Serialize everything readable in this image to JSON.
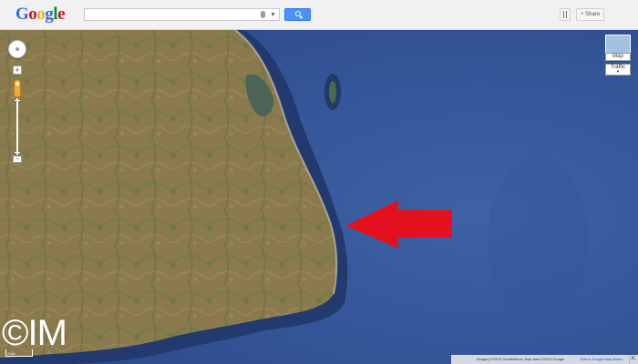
{
  "logo": {
    "letters": [
      "G",
      "o",
      "o",
      "g",
      "l",
      "e"
    ],
    "colors": [
      "#3369e8",
      "#d50f25",
      "#eeb211",
      "#3369e8",
      "#009925",
      "#d50f25"
    ]
  },
  "search": {
    "value": "",
    "button_icon": "search-icon"
  },
  "toolbar": {
    "share_label": "+ Share",
    "apps_icon": "apps-icon"
  },
  "map_controls": {
    "zoom_in_label": "+",
    "zoom_out_label": "−",
    "map_type_label": "Map",
    "traffic_label": "Traffic",
    "traffic_dropdown": "▾"
  },
  "footer": {
    "attribution": "Imagery ©2013 TerraMetrics, Map data ©2013 Google",
    "edit_link": "Edit in Google Map Maker",
    "scale": "2 km"
  },
  "watermark": "©IM",
  "colors": {
    "sea": "#35589a",
    "land": "#8a7a4e",
    "arrow": "#e5101e",
    "map_type_thumb": "#a3c2e2"
  }
}
